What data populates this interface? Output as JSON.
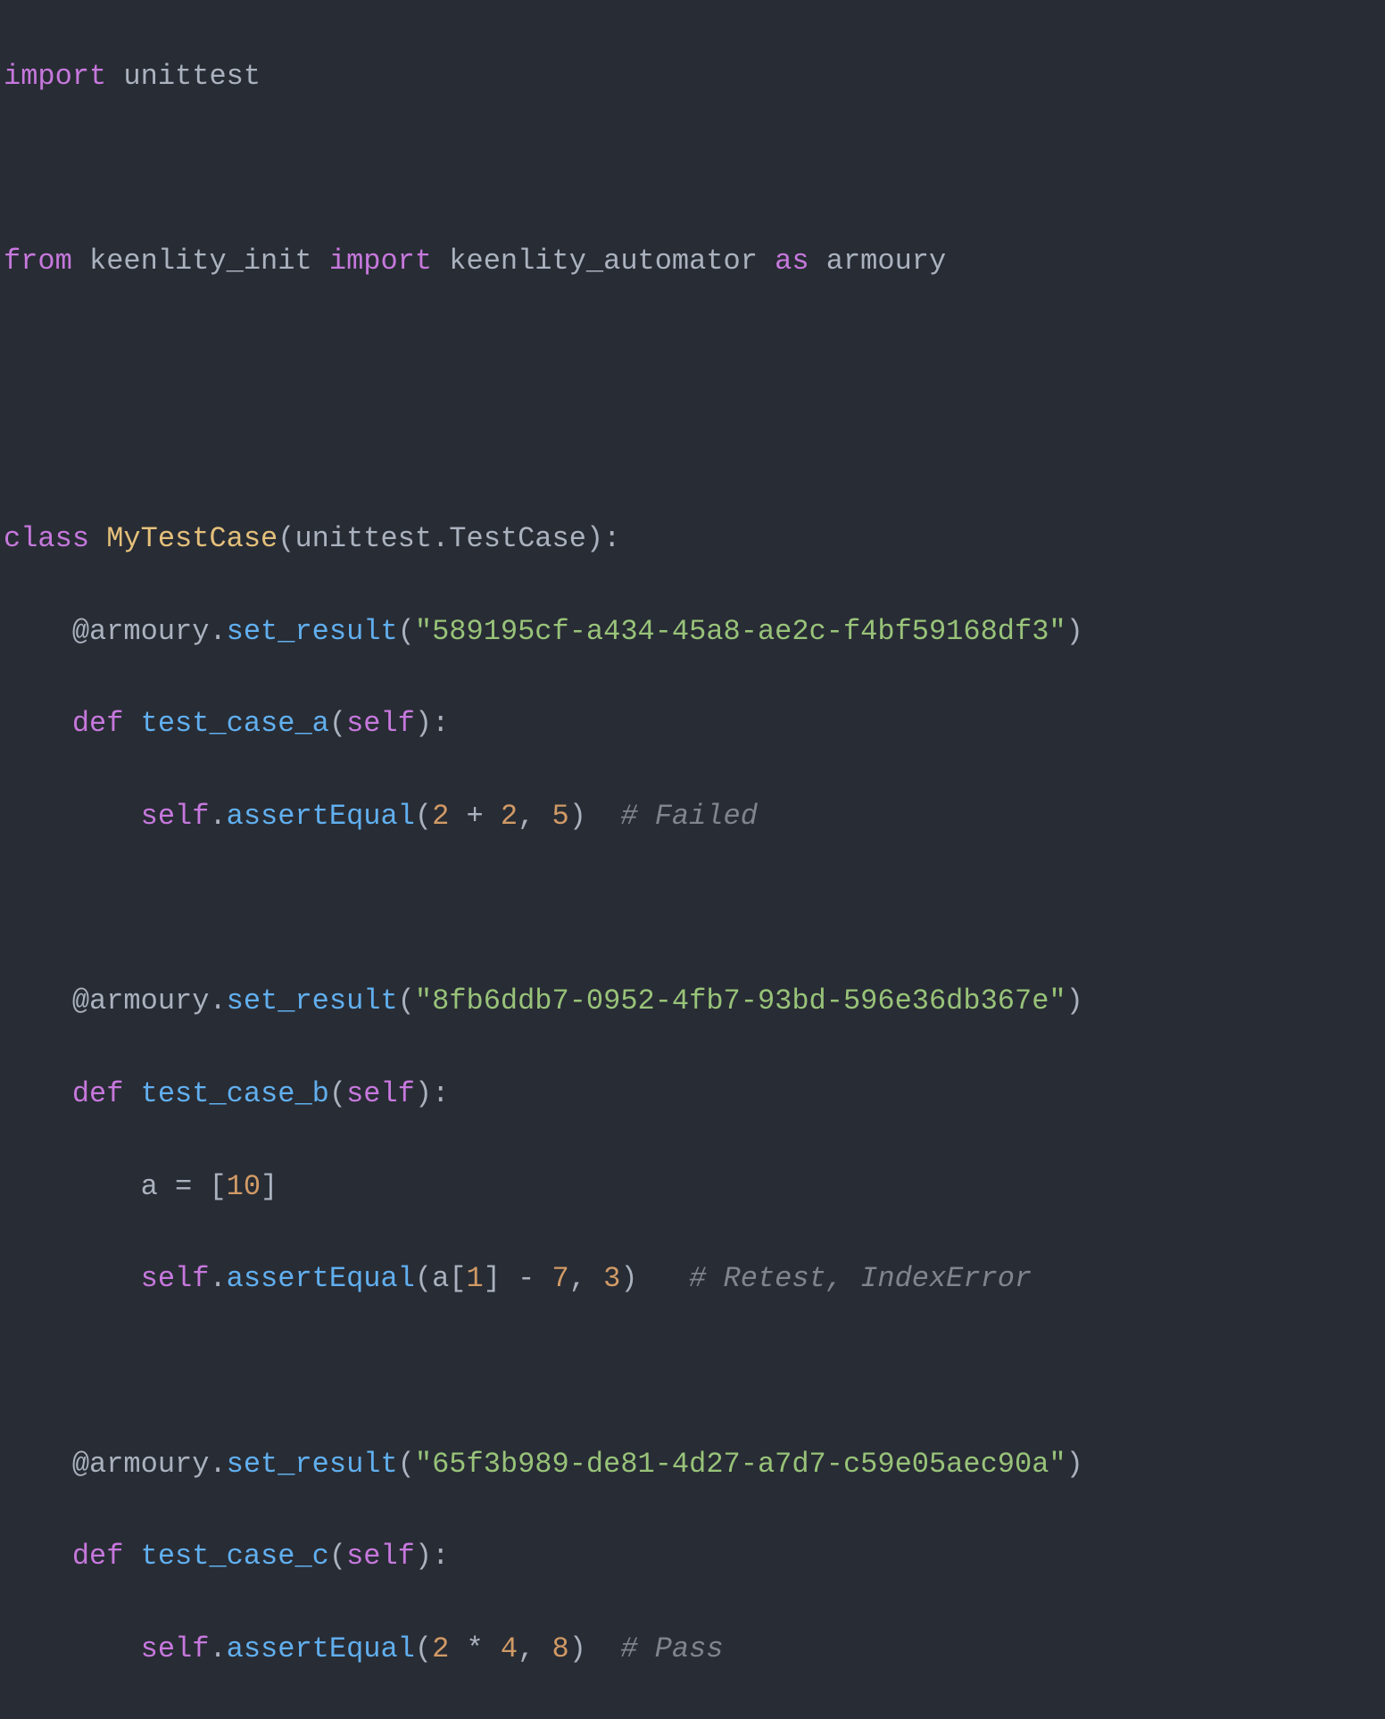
{
  "code": {
    "l1": {
      "kw_import": "import",
      "sp": " ",
      "mod": "unittest"
    },
    "l3": {
      "kw_from": "from",
      "sp1": " ",
      "mod1": "keenlity_init",
      "sp2": " ",
      "kw_import": "import",
      "sp3": " ",
      "mod2": "keenlity_automator",
      "sp4": " ",
      "kw_as": "as",
      "sp5": " ",
      "alias": "armoury"
    },
    "l6": {
      "kw_class": "class",
      "sp": " ",
      "name": "MyTestCase",
      "lp": "(",
      "base_mod": "unittest",
      "dot": ".",
      "base_cls": "TestCase",
      "rp": ")",
      "colon": ":"
    },
    "l7": {
      "indent": "    ",
      "at": "@",
      "deco_obj": "armoury",
      "dot": ".",
      "deco_method": "set_result",
      "lp": "(",
      "q1": "\"",
      "uuid": "589195cf-a434-45a8-ae2c-f4bf59168df3",
      "q2": "\"",
      "rp": ")"
    },
    "l8": {
      "indent": "    ",
      "kw_def": "def",
      "sp": " ",
      "fname": "test_case_a",
      "lp": "(",
      "self": "self",
      "rp": ")",
      "colon": ":"
    },
    "l9": {
      "indent": "        ",
      "self": "self",
      "dot": ".",
      "method": "assertEqual",
      "lp": "(",
      "n1": "2",
      "sp1": " ",
      "op": "+",
      "sp2": " ",
      "n2": "2",
      "comma": ",",
      "sp3": " ",
      "n3": "5",
      "rp": ")",
      "sp4": "  ",
      "comment": "# Failed"
    },
    "l11": {
      "indent": "    ",
      "at": "@",
      "deco_obj": "armoury",
      "dot": ".",
      "deco_method": "set_result",
      "lp": "(",
      "q1": "\"",
      "uuid": "8fb6ddb7-0952-4fb7-93bd-596e36db367e",
      "q2": "\"",
      "rp": ")"
    },
    "l12": {
      "indent": "    ",
      "kw_def": "def",
      "sp": " ",
      "fname": "test_case_b",
      "lp": "(",
      "self": "self",
      "rp": ")",
      "colon": ":"
    },
    "l13": {
      "indent": "        ",
      "var": "a",
      "sp1": " ",
      "eq": "=",
      "sp2": " ",
      "lb": "[",
      "n1": "10",
      "rb": "]"
    },
    "l14": {
      "indent": "        ",
      "self": "self",
      "dot": ".",
      "method": "assertEqual",
      "lp": "(",
      "var": "a",
      "lb": "[",
      "idx": "1",
      "rb": "]",
      "sp1": " ",
      "op": "-",
      "sp2": " ",
      "n2": "7",
      "comma": ",",
      "sp3": " ",
      "n3": "3",
      "rp": ")",
      "sp4": "   ",
      "comment": "# Retest, IndexError"
    },
    "l16": {
      "indent": "    ",
      "at": "@",
      "deco_obj": "armoury",
      "dot": ".",
      "deco_method": "set_result",
      "lp": "(",
      "q1": "\"",
      "uuid": "65f3b989-de81-4d27-a7d7-c59e05aec90a",
      "q2": "\"",
      "rp": ")"
    },
    "l17": {
      "indent": "    ",
      "kw_def": "def",
      "sp": " ",
      "fname": "test_case_c",
      "lp": "(",
      "self": "self",
      "rp": ")",
      "colon": ":"
    },
    "l18": {
      "indent": "        ",
      "self": "self",
      "dot": ".",
      "method": "assertEqual",
      "lp": "(",
      "n1": "2",
      "sp1": " ",
      "op": "*",
      "sp2": " ",
      "n2": "4",
      "comma": ",",
      "sp3": " ",
      "n3": "8",
      "rp": ")",
      "sp4": "  ",
      "comment": "# Pass"
    }
  }
}
